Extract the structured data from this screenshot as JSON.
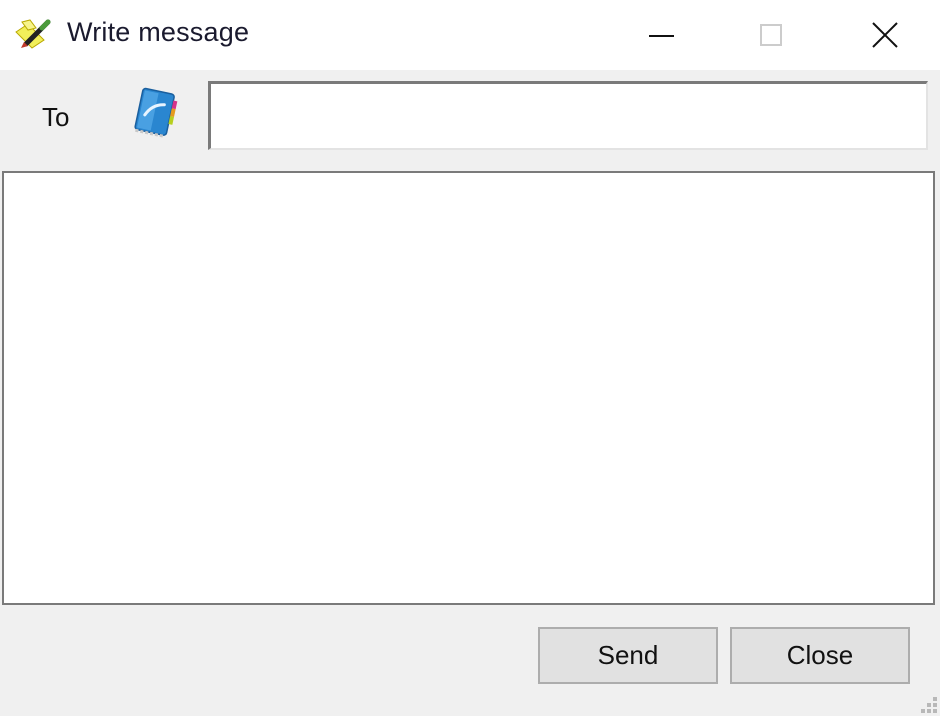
{
  "window": {
    "title": "Write message",
    "controls": {
      "minimize": "minimize-icon",
      "maximize": "maximize-icon",
      "close": "close-icon"
    }
  },
  "recipient": {
    "label": "To",
    "address_book_icon": "address-book-icon",
    "value": "",
    "placeholder": ""
  },
  "message": {
    "value": "",
    "placeholder": ""
  },
  "buttons": {
    "send_label": "Send",
    "close_label": "Close"
  }
}
